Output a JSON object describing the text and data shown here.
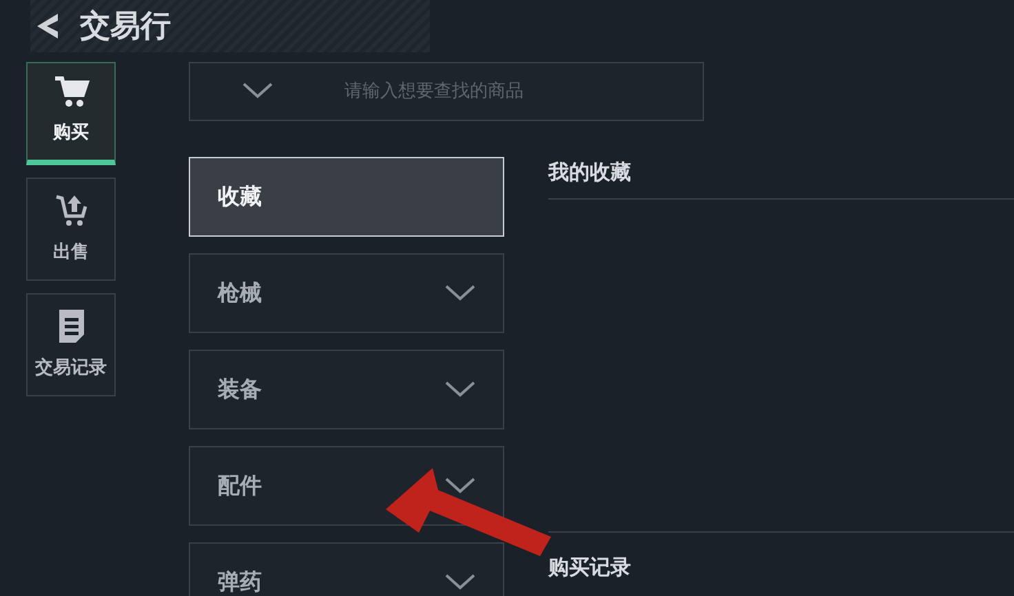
{
  "header": {
    "title": "交易行"
  },
  "nav": [
    {
      "label": "购买",
      "kind": "cart",
      "selected": true
    },
    {
      "label": "出售",
      "kind": "sell",
      "selected": false
    },
    {
      "label": "交易记录",
      "kind": "record",
      "selected": false
    }
  ],
  "search": {
    "placeholder": "请输入想要查找的商品"
  },
  "categories": [
    {
      "label": "收藏",
      "kind": "plain",
      "selected": true
    },
    {
      "label": "枪械",
      "kind": "dropdown",
      "selected": false
    },
    {
      "label": "装备",
      "kind": "dropdown",
      "selected": false
    },
    {
      "label": "配件",
      "kind": "dropdown",
      "selected": false
    },
    {
      "label": "弹药",
      "kind": "dropdown",
      "selected": false
    }
  ],
  "sections": [
    {
      "title": "我的收藏"
    },
    {
      "title": "购买记录"
    }
  ]
}
